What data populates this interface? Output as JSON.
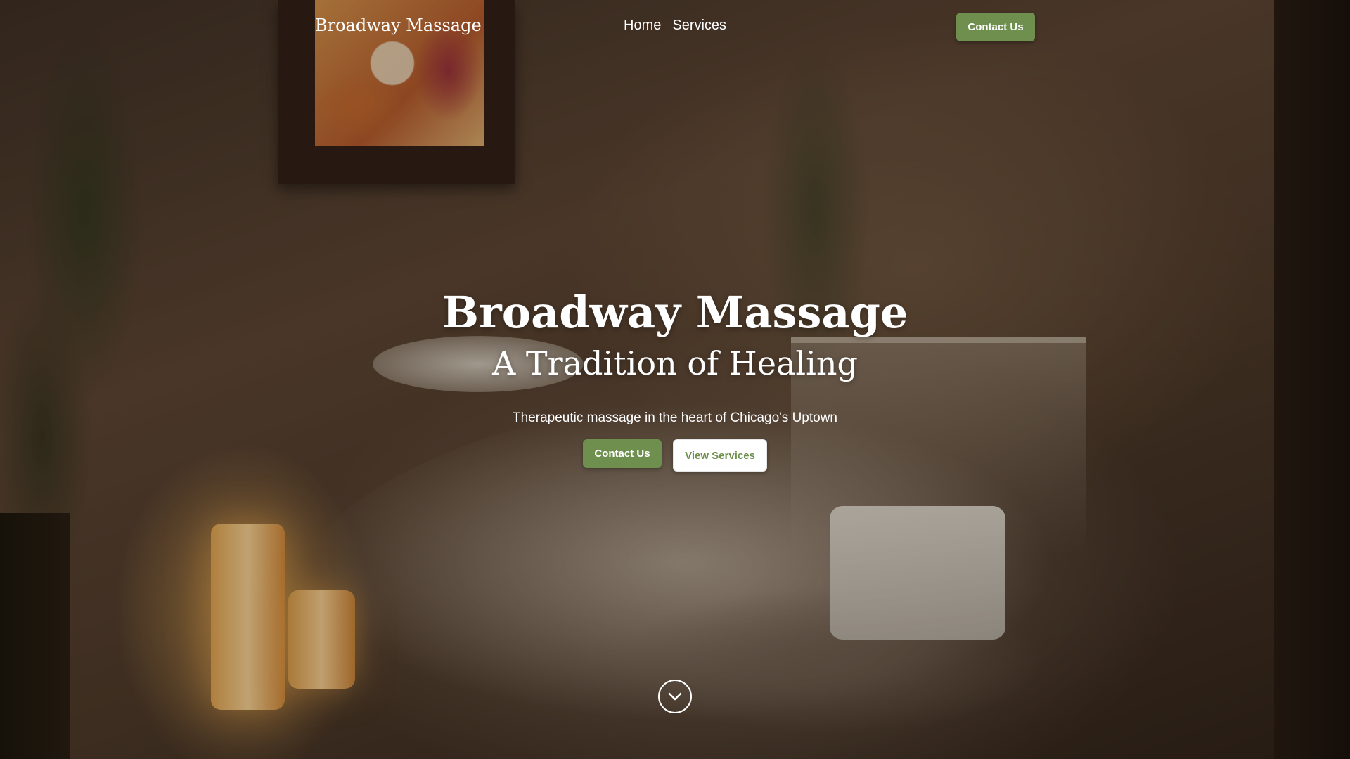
{
  "header": {
    "brand": "Broadway Massage",
    "nav": {
      "home": "Home",
      "services": "Services"
    },
    "contact_label": "Contact Us"
  },
  "hero": {
    "title": "Broadway Massage",
    "subtitle": "A Tradition of Healing",
    "tagline": "Therapeutic massage in the heart of Chicago's Uptown",
    "contact_label": "Contact Us",
    "services_label": "View Services",
    "scroll_icon": "chevron-down-circle-icon"
  },
  "colors": {
    "accent_green": "#6e8f4d",
    "text": "#ffffff"
  }
}
